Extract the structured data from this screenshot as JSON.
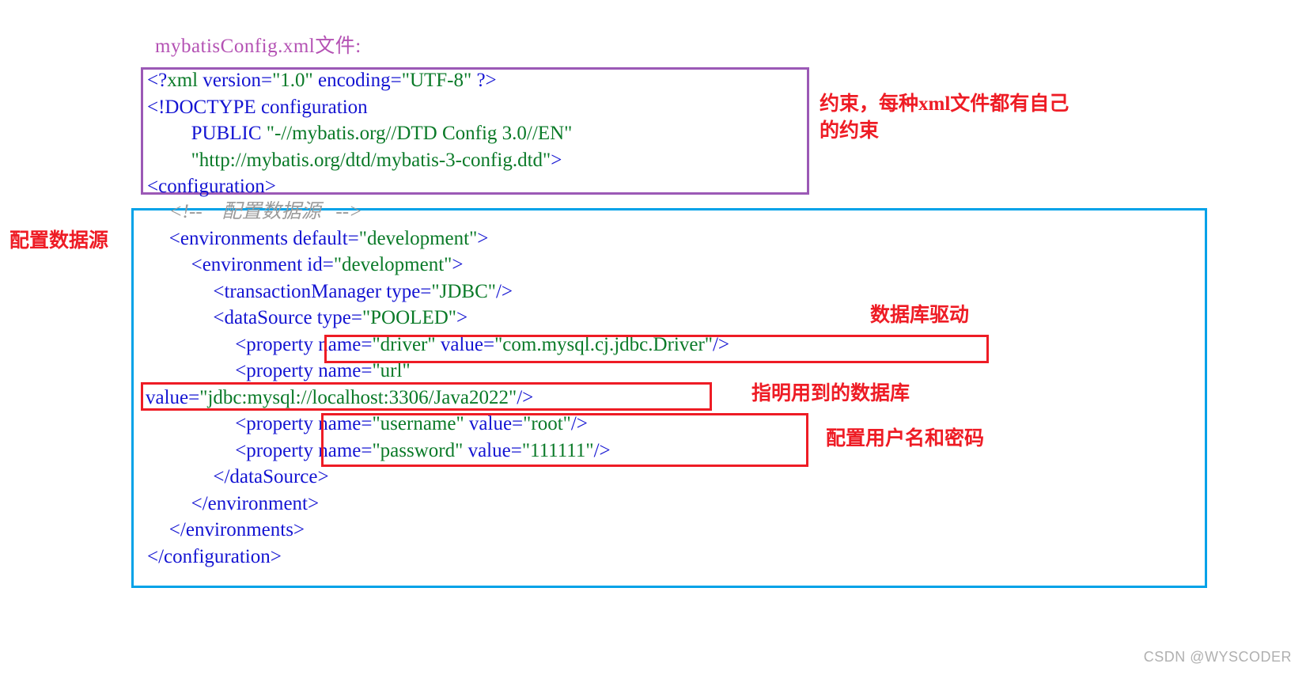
{
  "title": "mybatisConfig.xml文件:",
  "colors": {
    "title": "#b452b4",
    "doctype_box_border": "#9b59b6",
    "datasource_box_border": "#00a2e8",
    "highlight_box_border": "#ee1c25",
    "annotation": "#ee1c25",
    "tag": "#1414d2",
    "value": "#0a7a28",
    "comment": "#9b9b9b",
    "watermark": "#b0b0b0"
  },
  "code": {
    "doctype_block": [
      {
        "indent": 0,
        "parts": [
          {
            "t": "<?",
            "c": "tag"
          },
          {
            "t": "xml",
            "c": "val"
          },
          {
            "t": " version=",
            "c": "attr"
          },
          {
            "t": "\"1.0\"",
            "c": "val"
          },
          {
            "t": " encoding=",
            "c": "attr"
          },
          {
            "t": "\"UTF-8\"",
            "c": "val"
          },
          {
            "t": " ?>",
            "c": "tag"
          }
        ]
      },
      {
        "indent": 0,
        "parts": [
          {
            "t": "<!DOCTYPE configuration",
            "c": "tag"
          }
        ]
      },
      {
        "indent": 4,
        "parts": [
          {
            "t": "PUBLIC ",
            "c": "tag"
          },
          {
            "t": "\"-//mybatis.org//DTD Config 3.0//EN\"",
            "c": "val"
          }
        ]
      },
      {
        "indent": 4,
        "parts": [
          {
            "t": "\"http://mybatis.org/dtd/mybatis-3-config.dtd\"",
            "c": "val"
          },
          {
            "t": ">",
            "c": "tag"
          }
        ]
      },
      {
        "indent": 0,
        "parts": [
          {
            "t": "<configuration>",
            "c": "tag"
          }
        ]
      }
    ],
    "datasource_block": [
      {
        "indent": 2,
        "parts": [
          {
            "t": "<!--    配置数据源   -->",
            "c": "cmt"
          }
        ]
      },
      {
        "indent": 2,
        "parts": [
          {
            "t": "<environments default=",
            "c": "tag"
          },
          {
            "t": "\"development\"",
            "c": "val"
          },
          {
            "t": ">",
            "c": "tag"
          }
        ]
      },
      {
        "indent": 4,
        "parts": [
          {
            "t": "<environment id=",
            "c": "tag"
          },
          {
            "t": "\"development\"",
            "c": "val"
          },
          {
            "t": ">",
            "c": "tag"
          }
        ]
      },
      {
        "indent": 6,
        "parts": [
          {
            "t": "<transactionManager type=",
            "c": "tag"
          },
          {
            "t": "\"JDBC\"",
            "c": "val"
          },
          {
            "t": "/>",
            "c": "tag"
          }
        ]
      },
      {
        "indent": 6,
        "parts": [
          {
            "t": "<dataSource type=",
            "c": "tag"
          },
          {
            "t": "\"POOLED\"",
            "c": "val"
          },
          {
            "t": ">",
            "c": "tag"
          }
        ]
      },
      {
        "indent": 8,
        "parts": [
          {
            "t": "<property name=",
            "c": "tag"
          },
          {
            "t": "\"driver\"",
            "c": "val"
          },
          {
            "t": " value=",
            "c": "tag"
          },
          {
            "t": "\"com.mysql.cj.jdbc.Driver\"",
            "c": "val"
          },
          {
            "t": "/>",
            "c": "tag"
          }
        ]
      },
      {
        "indent": 8,
        "parts": [
          {
            "t": "<property name=",
            "c": "tag"
          },
          {
            "t": "\"url\"",
            "c": "val"
          }
        ]
      },
      {
        "indent": -100,
        "parts": [
          {
            "t": "value=",
            "c": "tag"
          },
          {
            "t": "\"jdbc:mysql://localhost:3306/Java2022\"",
            "c": "val"
          },
          {
            "t": "/>",
            "c": "tag"
          }
        ]
      },
      {
        "indent": 8,
        "parts": [
          {
            "t": "<property name=",
            "c": "tag"
          },
          {
            "t": "\"username\"",
            "c": "val"
          },
          {
            "t": " value=",
            "c": "tag"
          },
          {
            "t": "\"root\"",
            "c": "val"
          },
          {
            "t": "/>",
            "c": "tag"
          }
        ]
      },
      {
        "indent": 8,
        "parts": [
          {
            "t": "<property name=",
            "c": "tag"
          },
          {
            "t": "\"password\"",
            "c": "val"
          },
          {
            "t": " value=",
            "c": "tag"
          },
          {
            "t": "\"111111\"",
            "c": "val"
          },
          {
            "t": "/>",
            "c": "tag"
          }
        ]
      },
      {
        "indent": 6,
        "parts": [
          {
            "t": "</dataSource>",
            "c": "tag"
          }
        ]
      },
      {
        "indent": 4,
        "parts": [
          {
            "t": "</environment>",
            "c": "tag"
          }
        ]
      },
      {
        "indent": 2,
        "parts": [
          {
            "t": "</environments>",
            "c": "tag"
          }
        ]
      },
      {
        "indent": 0,
        "parts": [
          {
            "t": "</configuration>",
            "c": "tag"
          }
        ]
      }
    ]
  },
  "annotations": {
    "constraint": "约束，每种xml文件都有自己\n的约束",
    "datasource": "配置数据源",
    "driver": "数据库驱动",
    "database": "指明用到的数据库",
    "userpass": "配置用户名和密码"
  },
  "watermark": "CSDN @WYSCODER"
}
